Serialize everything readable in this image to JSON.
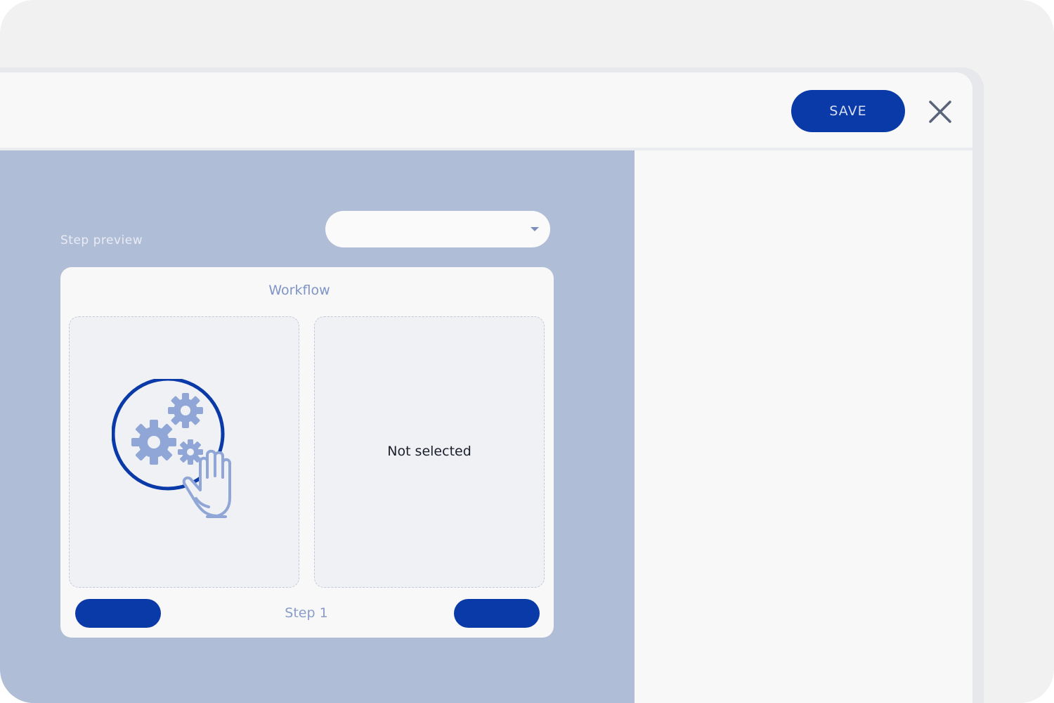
{
  "header": {
    "save_label": "SAVE"
  },
  "preview": {
    "label": "Step preview",
    "select_value": "",
    "card_title": "Workflow",
    "empty_slot_text": "Not selected",
    "step_label": "Step 1"
  },
  "icons": {
    "close": "close-icon",
    "caret": "chevron-down-icon",
    "illustration": "workflow-gears-hand-icon"
  },
  "colors": {
    "accent": "#0a3aa8",
    "panel": "#b0bdd6",
    "illustration_light": "#8fa6d6"
  }
}
